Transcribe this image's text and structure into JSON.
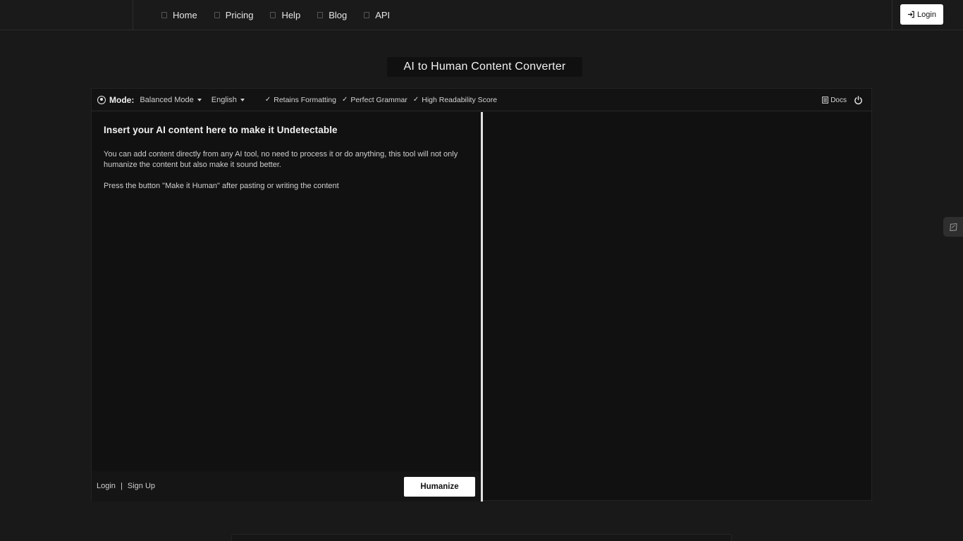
{
  "nav": {
    "items": [
      {
        "label": "Home",
        "icon": "home-icon"
      },
      {
        "label": "Pricing",
        "icon": "pricing-icon"
      },
      {
        "label": "Help",
        "icon": "help-icon"
      },
      {
        "label": "Blog",
        "icon": "blog-icon"
      },
      {
        "label": "API",
        "icon": "api-icon"
      }
    ],
    "login_label": "Login"
  },
  "page_title": "AI to Human Content Converter",
  "toolbar": {
    "mode_label": "Mode:",
    "mode_value": "Balanced Mode",
    "language_value": "English",
    "features": [
      "Retains Formatting",
      "Perfect Grammar",
      "High Readability Score"
    ],
    "docs_label": "Docs"
  },
  "editor": {
    "heading": "Insert your AI content here to make it Undetectable",
    "paragraph1": "You can add content directly from any AI tool, no need to process it or do anything, this tool will not only humanize the content but also make it sound better.",
    "paragraph2": "Press the button \"Make it Human\" after pasting or writing the content",
    "login_link": "Login",
    "separator": "|",
    "signup_link": "Sign Up",
    "humanize_label": "Humanize"
  },
  "colors": {
    "background": "#191919",
    "panel": "#111111",
    "primary_button": "#ffffff",
    "divider": "#e0e0e0"
  }
}
